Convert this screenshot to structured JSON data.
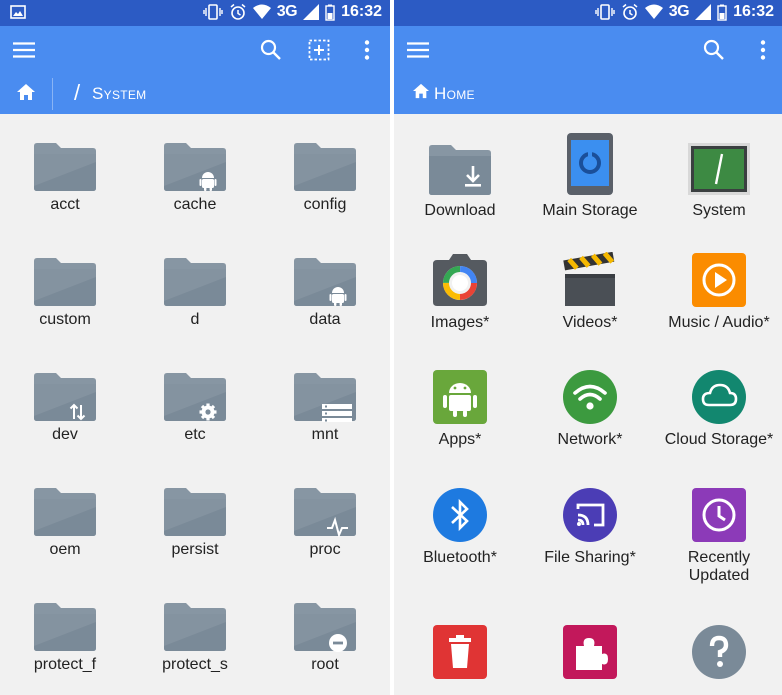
{
  "left": {
    "status": {
      "network": "3G",
      "time": "16:32"
    },
    "path": {
      "label": "System"
    },
    "folders": [
      {
        "label": "acct",
        "badge": "none"
      },
      {
        "label": "cache",
        "badge": "android"
      },
      {
        "label": "config",
        "badge": "none"
      },
      {
        "label": "custom",
        "badge": "none"
      },
      {
        "label": "d",
        "badge": "none"
      },
      {
        "label": "data",
        "badge": "android"
      },
      {
        "label": "dev",
        "badge": "arrows"
      },
      {
        "label": "etc",
        "badge": "gear"
      },
      {
        "label": "mnt",
        "badge": "list"
      },
      {
        "label": "oem",
        "badge": "none"
      },
      {
        "label": "persist",
        "badge": "none"
      },
      {
        "label": "proc",
        "badge": "pulse"
      },
      {
        "label": "protect_f",
        "badge": "none"
      },
      {
        "label": "protect_s",
        "badge": "none"
      },
      {
        "label": "root",
        "badge": "minus"
      }
    ]
  },
  "right": {
    "status": {
      "network": "3G",
      "time": "16:32"
    },
    "path": {
      "label": "Home"
    },
    "items": [
      {
        "label": "Download",
        "icon": "download-folder-icon"
      },
      {
        "label": "Main Storage",
        "icon": "phone-storage-icon"
      },
      {
        "label": "System",
        "icon": "system-terminal-icon"
      },
      {
        "label": "Images*",
        "icon": "camera-icon"
      },
      {
        "label": "Videos*",
        "icon": "clapperboard-icon"
      },
      {
        "label": "Music / Audio*",
        "icon": "play-icon"
      },
      {
        "label": "Apps*",
        "icon": "android-icon"
      },
      {
        "label": "Network*",
        "icon": "wifi-icon"
      },
      {
        "label": "Cloud Storage*",
        "icon": "cloud-icon"
      },
      {
        "label": "Bluetooth*",
        "icon": "bluetooth-icon"
      },
      {
        "label": "File Sharing*",
        "icon": "cast-icon"
      },
      {
        "label": "Recently Updated",
        "icon": "clock-icon"
      },
      {
        "label": "",
        "icon": "trash-icon"
      },
      {
        "label": "",
        "icon": "puzzle-icon"
      },
      {
        "label": "",
        "icon": "help-icon"
      }
    ]
  },
  "colors": {
    "statusbar": "#2c5bc4",
    "toolbar": "#4a8cf0",
    "folder": "#7a8a98",
    "background": "#f1f1f1"
  }
}
